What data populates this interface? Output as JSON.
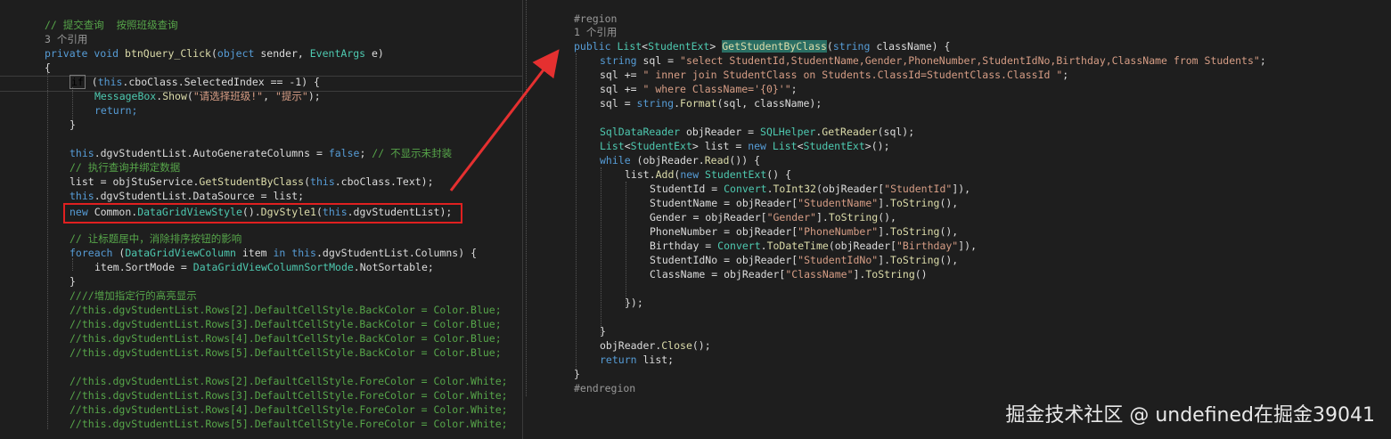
{
  "left": {
    "lines": [
      [
        [
          "// 提交查询  按照班级查询",
          "comment"
        ]
      ],
      [
        [
          "3 个引用",
          "meta"
        ]
      ],
      [
        [
          "private void ",
          "kw"
        ],
        [
          "btnQuery_Click",
          "method"
        ],
        [
          "(",
          "plain"
        ],
        [
          "object",
          "kw"
        ],
        [
          " sender, ",
          "plain"
        ],
        [
          "EventArgs",
          "type"
        ],
        [
          " e)",
          "plain"
        ]
      ],
      [
        [
          "{",
          "plain"
        ]
      ],
      [
        [
          "if",
          "kwbox"
        ],
        [
          " (",
          "plain"
        ],
        [
          "this",
          "kw"
        ],
        [
          ".cboClass.SelectedIndex == -1) {",
          "plain"
        ]
      ],
      [
        [
          "MessageBox",
          "type"
        ],
        [
          ".",
          "plain"
        ],
        [
          "Show",
          "method"
        ],
        [
          "(",
          "plain"
        ],
        [
          "\"请选择班级!\"",
          "string"
        ],
        [
          ", ",
          "plain"
        ],
        [
          "\"提示\"",
          "string"
        ],
        [
          ");",
          "plain"
        ]
      ],
      [
        [
          "return;",
          "kw"
        ]
      ],
      [
        [
          "}",
          "plain"
        ]
      ],
      [
        [
          "this",
          "kw"
        ],
        [
          ".dgvStudentList.AutoGenerateColumns = ",
          "plain"
        ],
        [
          "false",
          "kw"
        ],
        [
          "; ",
          "plain"
        ],
        [
          "// 不显示未封装",
          "comment"
        ]
      ],
      [
        [
          "// 执行查询并绑定数据",
          "comment"
        ]
      ],
      [
        [
          "list = objStuService.",
          "plain"
        ],
        [
          "GetStudentByClass",
          "method"
        ],
        [
          "(",
          "plain"
        ],
        [
          "this",
          "kw"
        ],
        [
          ".cboClass.Text);",
          "plain"
        ]
      ],
      [
        [
          "this",
          "kw"
        ],
        [
          ".dgvStudentList.DataSource = list;",
          "plain"
        ]
      ],
      [
        [
          "new ",
          "kw"
        ],
        [
          "Common",
          "plain"
        ],
        [
          ".",
          "plain"
        ],
        [
          "DataGridViewStyle",
          "type"
        ],
        [
          "().",
          "plain"
        ],
        [
          "DgvStyle1",
          "method"
        ],
        [
          "(",
          "plain"
        ],
        [
          "this",
          "kw"
        ],
        [
          ".dgvStudentList);",
          "plain"
        ]
      ],
      [
        [
          "// 让标题居中，消除排序按钮的影响",
          "comment"
        ]
      ],
      [
        [
          "foreach",
          "kw"
        ],
        [
          " (",
          "plain"
        ],
        [
          "DataGridViewColumn",
          "type"
        ],
        [
          " item ",
          "plain"
        ],
        [
          "in ",
          "kw"
        ],
        [
          "this",
          "kw"
        ],
        [
          ".dgvStudentList.Columns) {",
          "plain"
        ]
      ],
      [
        [
          "item.SortMode = ",
          "plain"
        ],
        [
          "DataGridViewColumnSortMode",
          "type"
        ],
        [
          ".NotSortable;",
          "plain"
        ]
      ],
      [
        [
          "}",
          "plain"
        ]
      ],
      [
        [
          "////增加指定行的高亮显示",
          "comment"
        ]
      ],
      [
        [
          "//this.dgvStudentList.Rows[2].DefaultCellStyle.BackColor = Color.Blue;",
          "comment"
        ]
      ],
      [
        [
          "//this.dgvStudentList.Rows[3].DefaultCellStyle.BackColor = Color.Blue;",
          "comment"
        ]
      ],
      [
        [
          "//this.dgvStudentList.Rows[4].DefaultCellStyle.BackColor = Color.Blue;",
          "comment"
        ]
      ],
      [
        [
          "//this.dgvStudentList.Rows[5].DefaultCellStyle.BackColor = Color.Blue;",
          "comment"
        ]
      ],
      [
        [
          "//this.dgvStudentList.Rows[2].DefaultCellStyle.ForeColor = Color.White;",
          "comment"
        ]
      ],
      [
        [
          "//this.dgvStudentList.Rows[3].DefaultCellStyle.ForeColor = Color.White;",
          "comment"
        ]
      ],
      [
        [
          "//this.dgvStudentList.Rows[4].DefaultCellStyle.ForeColor = Color.White;",
          "comment"
        ]
      ],
      [
        [
          "//this.dgvStudentList.Rows[5].DefaultCellStyle.ForeColor = Color.White;",
          "comment"
        ]
      ]
    ]
  },
  "right": {
    "lines": [
      [
        [
          "#region",
          "meta"
        ]
      ],
      [
        [
          "1 个引用",
          "meta"
        ]
      ],
      [
        [
          "public ",
          "kw"
        ],
        [
          "List",
          "type"
        ],
        [
          "<",
          "plain"
        ],
        [
          "StudentExt",
          "type"
        ],
        [
          "> ",
          "plain"
        ],
        [
          "GetStudentByClass",
          "hl"
        ],
        [
          "(",
          "plain"
        ],
        [
          "string",
          "kw"
        ],
        [
          " className) {",
          "plain"
        ]
      ],
      [
        [
          "string",
          "kw"
        ],
        [
          " sql = ",
          "plain"
        ],
        [
          "\"select StudentId,StudentName,Gender,PhoneNumber,StudentIdNo,Birthday,ClassName from Students\"",
          "string"
        ],
        [
          ";",
          "plain"
        ]
      ],
      [
        [
          "sql += ",
          "plain"
        ],
        [
          "\" inner join StudentClass on Students.ClassId=StudentClass.ClassId \"",
          "string"
        ],
        [
          ";",
          "plain"
        ]
      ],
      [
        [
          "sql += ",
          "plain"
        ],
        [
          "\" where ClassName='{0}'\"",
          "string"
        ],
        [
          ";",
          "plain"
        ]
      ],
      [
        [
          "sql = ",
          "plain"
        ],
        [
          "string",
          "kw"
        ],
        [
          ".",
          "plain"
        ],
        [
          "Format",
          "method"
        ],
        [
          "(sql, className);",
          "plain"
        ]
      ],
      [
        [
          "SqlDataReader",
          "type"
        ],
        [
          " objReader = ",
          "plain"
        ],
        [
          "SQLHelper",
          "type"
        ],
        [
          ".",
          "plain"
        ],
        [
          "GetReader",
          "method"
        ],
        [
          "(sql);",
          "plain"
        ]
      ],
      [
        [
          "List",
          "type"
        ],
        [
          "<",
          "plain"
        ],
        [
          "StudentExt",
          "type"
        ],
        [
          "> list = ",
          "plain"
        ],
        [
          "new ",
          "kw"
        ],
        [
          "List",
          "type"
        ],
        [
          "<",
          "plain"
        ],
        [
          "StudentExt",
          "type"
        ],
        [
          ">();",
          "plain"
        ]
      ],
      [
        [
          "while",
          "kw"
        ],
        [
          " (objReader.",
          "plain"
        ],
        [
          "Read",
          "method"
        ],
        [
          "()) {",
          "plain"
        ]
      ],
      [
        [
          "list.",
          "plain"
        ],
        [
          "Add",
          "method"
        ],
        [
          "(",
          "plain"
        ],
        [
          "new ",
          "kw"
        ],
        [
          "StudentExt",
          "type"
        ],
        [
          "() {",
          "plain"
        ]
      ],
      [
        [
          "StudentId = ",
          "plain"
        ],
        [
          "Convert",
          "type"
        ],
        [
          ".",
          "plain"
        ],
        [
          "ToInt32",
          "method"
        ],
        [
          "(objReader[",
          "plain"
        ],
        [
          "\"StudentId\"",
          "string"
        ],
        [
          "]),",
          "plain"
        ]
      ],
      [
        [
          "StudentName = objReader[",
          "plain"
        ],
        [
          "\"StudentName\"",
          "string"
        ],
        [
          "].",
          "plain"
        ],
        [
          "ToString",
          "method"
        ],
        [
          "(),",
          "plain"
        ]
      ],
      [
        [
          "Gender = objReader[",
          "plain"
        ],
        [
          "\"Gender\"",
          "string"
        ],
        [
          "].",
          "plain"
        ],
        [
          "ToString",
          "method"
        ],
        [
          "(),",
          "plain"
        ]
      ],
      [
        [
          "PhoneNumber = objReader[",
          "plain"
        ],
        [
          "\"PhoneNumber\"",
          "string"
        ],
        [
          "].",
          "plain"
        ],
        [
          "ToString",
          "method"
        ],
        [
          "(),",
          "plain"
        ]
      ],
      [
        [
          "Birthday = ",
          "plain"
        ],
        [
          "Convert",
          "type"
        ],
        [
          ".",
          "plain"
        ],
        [
          "ToDateTime",
          "method"
        ],
        [
          "(objReader[",
          "plain"
        ],
        [
          "\"Birthday\"",
          "string"
        ],
        [
          "]),",
          "plain"
        ]
      ],
      [
        [
          "StudentIdNo = objReader[",
          "plain"
        ],
        [
          "\"StudentIdNo\"",
          "string"
        ],
        [
          "].",
          "plain"
        ],
        [
          "ToString",
          "method"
        ],
        [
          "(),",
          "plain"
        ]
      ],
      [
        [
          "ClassName = objReader[",
          "plain"
        ],
        [
          "\"ClassName\"",
          "string"
        ],
        [
          "].",
          "plain"
        ],
        [
          "ToString",
          "method"
        ],
        [
          "()",
          "plain"
        ]
      ],
      [
        [
          "});",
          "plain"
        ]
      ],
      [
        [
          "}",
          "plain"
        ]
      ],
      [
        [
          "objReader.",
          "plain"
        ],
        [
          "Close",
          "method"
        ],
        [
          "();",
          "plain"
        ]
      ],
      [
        [
          "return",
          "kw"
        ],
        [
          " list;",
          "plain"
        ]
      ],
      [
        [
          "}",
          "plain"
        ]
      ],
      [
        [
          "#endregion",
          "meta"
        ]
      ]
    ]
  },
  "watermark": "掘金技术社区 @ undefined在掘金39041"
}
